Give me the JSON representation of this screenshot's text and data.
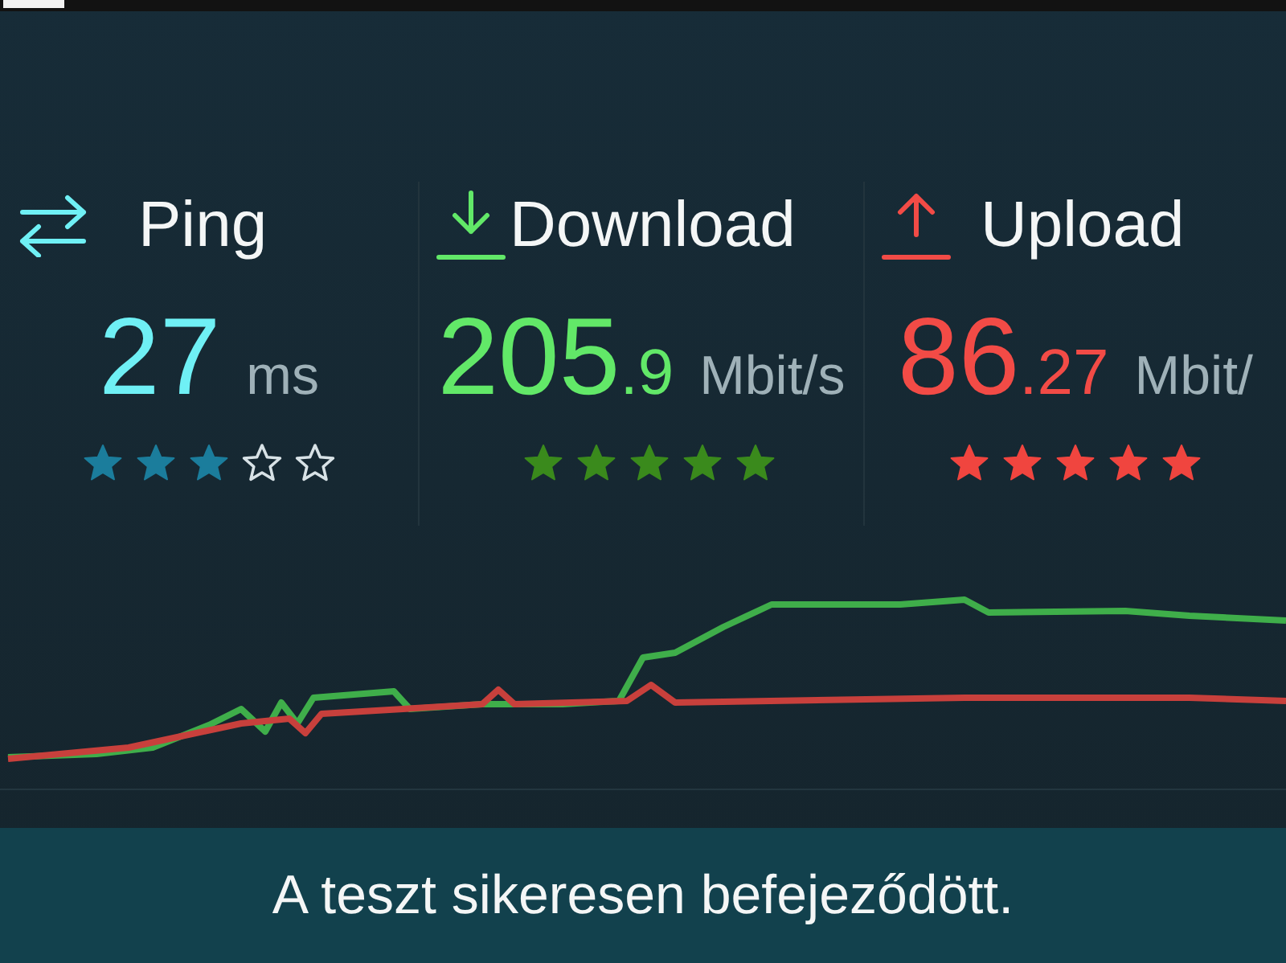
{
  "metrics": [
    {
      "kind": "ping",
      "label": "Ping",
      "value": "27",
      "unit": "ms",
      "stars": 3,
      "color": "#6ff0f5"
    },
    {
      "kind": "download",
      "label": "Download",
      "value": "205",
      "decimals": ".9",
      "unit": "Mbit/s",
      "stars": 5,
      "color": "#62e868"
    },
    {
      "kind": "upload",
      "label": "Upload",
      "value": "86",
      "decimals": ".27",
      "unit": "Mbit/",
      "stars": 5,
      "color": "#f24b46"
    }
  ],
  "status_message": "A teszt sikeresen befejeződött."
}
